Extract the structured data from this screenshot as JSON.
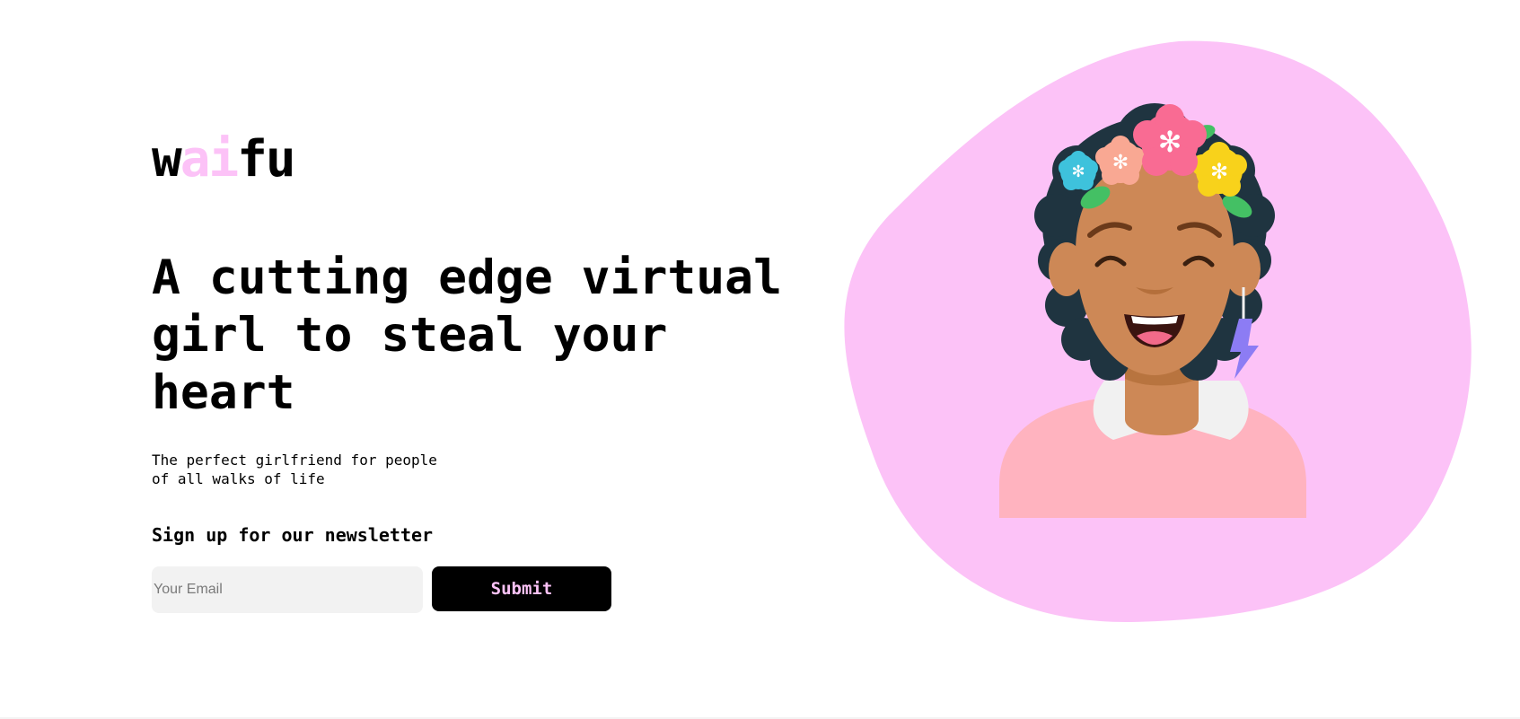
{
  "brand": {
    "logo_part1": "w",
    "logo_accent": "ai",
    "logo_part2": "fu",
    "accent_color": "#fcc2f7"
  },
  "hero": {
    "headline": "A cutting edge virtual girl to steal your heart",
    "subheading": "The perfect girlfriend for people of all walks of life"
  },
  "newsletter": {
    "title": "Sign up for our newsletter",
    "email_placeholder": "Your Email",
    "email_value": "",
    "submit_label": "Submit"
  },
  "illustration": {
    "blob_color": "#fcc2f7",
    "icon": "smiling-girl-avatar-with-flower-crown"
  }
}
